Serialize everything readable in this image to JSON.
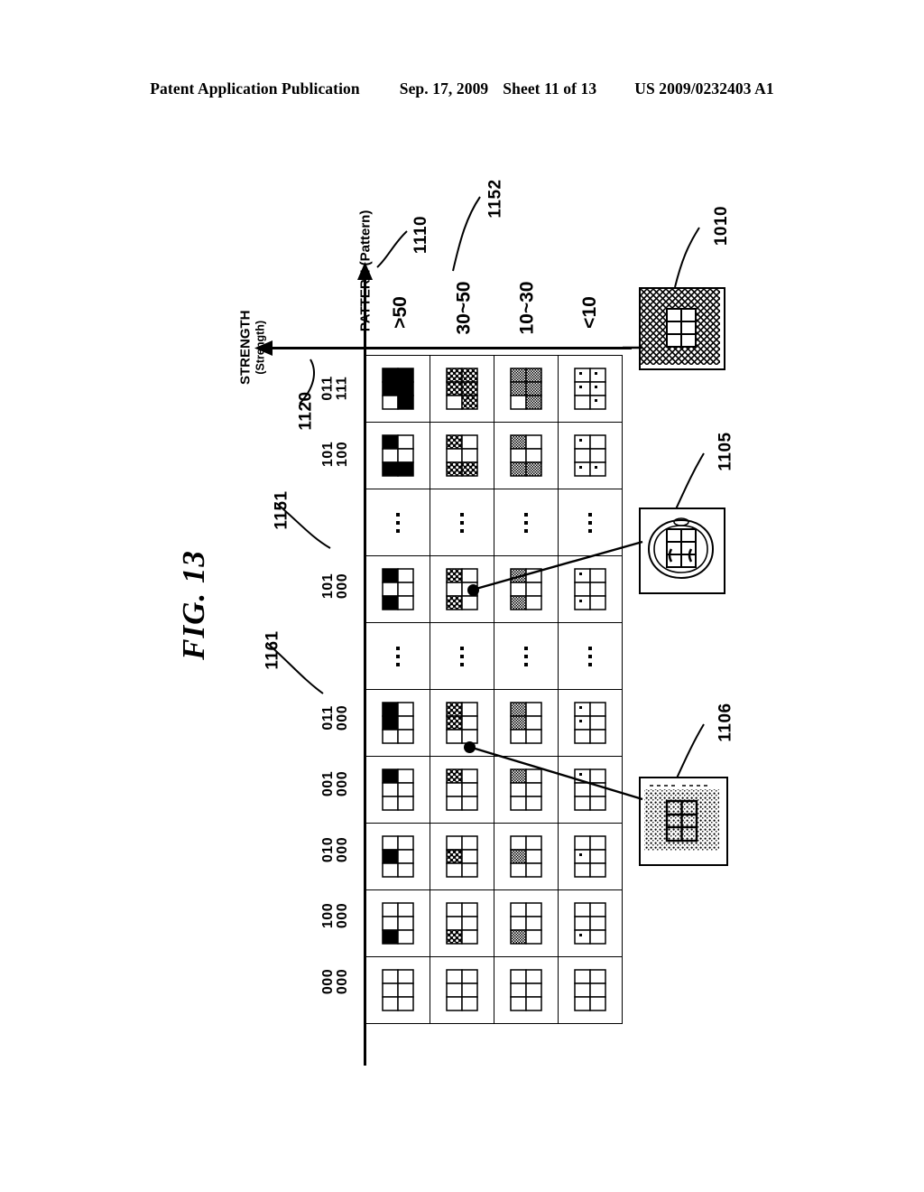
{
  "header": {
    "publication": "Patent Application Publication",
    "date": "Sep. 17, 2009",
    "sheet": "Sheet 11 of 13",
    "patent_number": "US 2009/0232403 A1"
  },
  "figure": {
    "label": "FIG. 13",
    "axes": {
      "y_axis_title": "STRENGTH",
      "y_axis_subtitle": "(Strength)",
      "y_axis_ref": "1120",
      "x_axis_title": "PATTERN (Pattern)",
      "x_axis_ref": "1110"
    },
    "refs": {
      "column_header_ref": "1152",
      "row_1151": "1151",
      "row_1161": "1161",
      "callout_1010": "1010",
      "callout_1105": "1105",
      "callout_1106": "1106"
    },
    "columns": [
      {
        "label": ">50",
        "fill": "solid"
      },
      {
        "label": "30~50",
        "fill": "coarse-dots"
      },
      {
        "label": "10~30",
        "fill": "fine-dots"
      },
      {
        "label": "<10",
        "fill": "single-dot"
      }
    ],
    "rows": [
      {
        "type": "data",
        "code_top": "011",
        "code_bottom": "111",
        "filled": [
          1,
          1,
          1,
          1,
          0,
          1
        ]
      },
      {
        "type": "data",
        "code_top": "101",
        "code_bottom": "100",
        "filled": [
          1,
          0,
          0,
          0,
          1,
          1
        ]
      },
      {
        "type": "ellipsis",
        "code_top": "",
        "code_bottom": "",
        "filled": []
      },
      {
        "type": "data",
        "code_top": "101",
        "code_bottom": "000",
        "filled": [
          1,
          0,
          0,
          0,
          1,
          0
        ]
      },
      {
        "type": "ellipsis",
        "code_top": "",
        "code_bottom": "",
        "filled": []
      },
      {
        "type": "data",
        "code_top": "011",
        "code_bottom": "000",
        "filled": [
          1,
          0,
          1,
          0,
          0,
          0
        ]
      },
      {
        "type": "data",
        "code_top": "001",
        "code_bottom": "000",
        "filled": [
          1,
          0,
          0,
          0,
          0,
          0
        ]
      },
      {
        "type": "data",
        "code_top": "010",
        "code_bottom": "000",
        "filled": [
          0,
          0,
          1,
          0,
          0,
          0
        ]
      },
      {
        "type": "data",
        "code_top": "100",
        "code_bottom": "000",
        "filled": [
          0,
          0,
          0,
          0,
          1,
          0
        ]
      },
      {
        "type": "data",
        "code_top": "000",
        "code_bottom": "000",
        "filled": [
          0,
          0,
          0,
          0,
          0,
          0
        ]
      }
    ],
    "callouts": [
      {
        "id": "1010",
        "kind": "crosshatch-block",
        "description": "cross-hatched image block with grid"
      },
      {
        "id": "1105",
        "kind": "face-image",
        "description": "face outline image with grid overlay"
      },
      {
        "id": "1106",
        "kind": "textured-image",
        "description": "textured pattern image with grid overlay"
      }
    ]
  }
}
